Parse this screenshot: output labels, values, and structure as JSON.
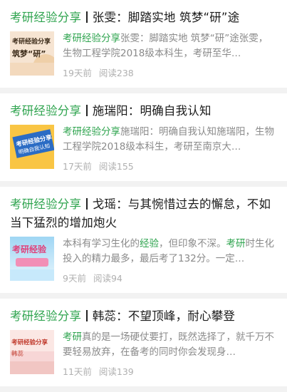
{
  "articles": [
    {
      "tag": "考研经验分享",
      "title": "张雯：脚踏实地 筑梦“研”途",
      "summary_hl": "考研经验分享",
      "summary_rest": "张雯：脚踏实地 筑梦“研”途张雯，生物工程学院2018级本科生，考研至华…",
      "time": "19天前",
      "reads": "阅读238",
      "thumb_text_1": "考研经验分享",
      "thumb_text_2": "筑梦“研”"
    },
    {
      "tag": "考研经验分享",
      "title": "施瑞阳：明确自我认知",
      "summary_hl": "考研经验分享",
      "summary_rest": "施瑞阳：明确自我认知施瑞阳，生物工程学院2018级本科生，考研至南京大…",
      "time": "17天前",
      "reads": "阅读155",
      "thumb_text_1": "考研经验分享",
      "thumb_text_2": "明确自我认知"
    },
    {
      "tag": "考研经验分享",
      "title": "戈瑶：与其惋惜过去的懈怠，不如当下猛烈的增加炮火",
      "summary_p1": "本科有学习生化的",
      "summary_hl1": "经验",
      "summary_p2": "，但印象不深。",
      "summary_hl2": "考研",
      "summary_p3": "时生化投入的精力最多，最后考了132分。一定…",
      "time": "9天前",
      "reads": "阅读94",
      "thumb_text_1": "考研经验"
    },
    {
      "tag": "考研经验分享",
      "title": "韩蕊：不望顶峰，耐心攀登",
      "summary_hl": "考研",
      "summary_rest": "真的是一场硬仗要打，既然选择了，就千万不要轻易放弃，在备考的同时你会发现身…",
      "time": "11天前",
      "reads": "阅读139",
      "thumb_text_1": "考研经验分享",
      "thumb_text_2": "韩蕊"
    }
  ]
}
